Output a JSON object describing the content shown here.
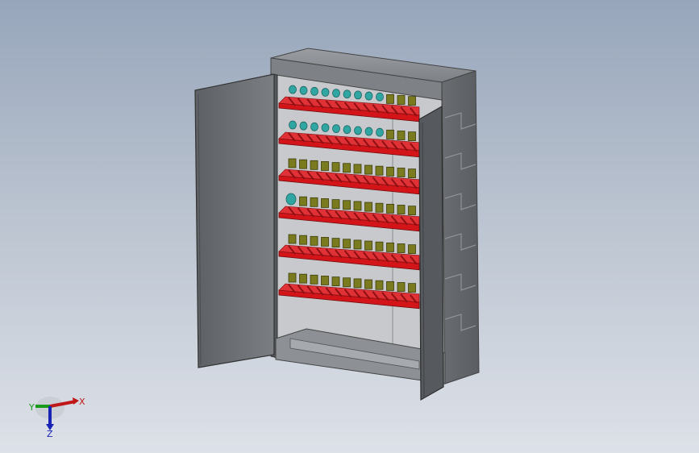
{
  "viewport": {
    "background_top": "#97a6bb",
    "background_bottom": "#dde1e8"
  },
  "model": {
    "description_icon": "tool-cabinet-3d-model",
    "shelf_color": "#d3151a",
    "holder_color": "#7a7a1e",
    "cyan_holder_color": "#2fa6a2",
    "body_color": "#6b6e72",
    "shelf_count": 6
  },
  "triad": {
    "x_label": "X",
    "y_label": "Y",
    "z_label": "Z",
    "x_color": "#c01818",
    "y_color": "#1a9a1a",
    "z_color": "#1a24b4"
  }
}
